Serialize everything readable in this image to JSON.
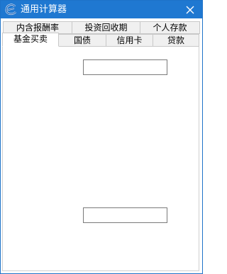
{
  "window": {
    "title": "通用计算器",
    "icon": "app-e-icon",
    "close_icon": "close-icon"
  },
  "tabs": {
    "row1": [
      {
        "label": "内含报酬率"
      },
      {
        "label": "投资回收期"
      },
      {
        "label": "个人存款"
      }
    ],
    "row2": [
      {
        "label": "基金买卖",
        "selected": true
      },
      {
        "label": "国债"
      },
      {
        "label": "信用卡"
      },
      {
        "label": "贷款"
      }
    ]
  },
  "fund_tab": {
    "input1": {
      "value": ""
    },
    "input2": {
      "value": ""
    }
  },
  "colors": {
    "titlebar": "#1f78d1",
    "tab_bg": "#f0f0f0",
    "content_bg": "#ffffff"
  }
}
